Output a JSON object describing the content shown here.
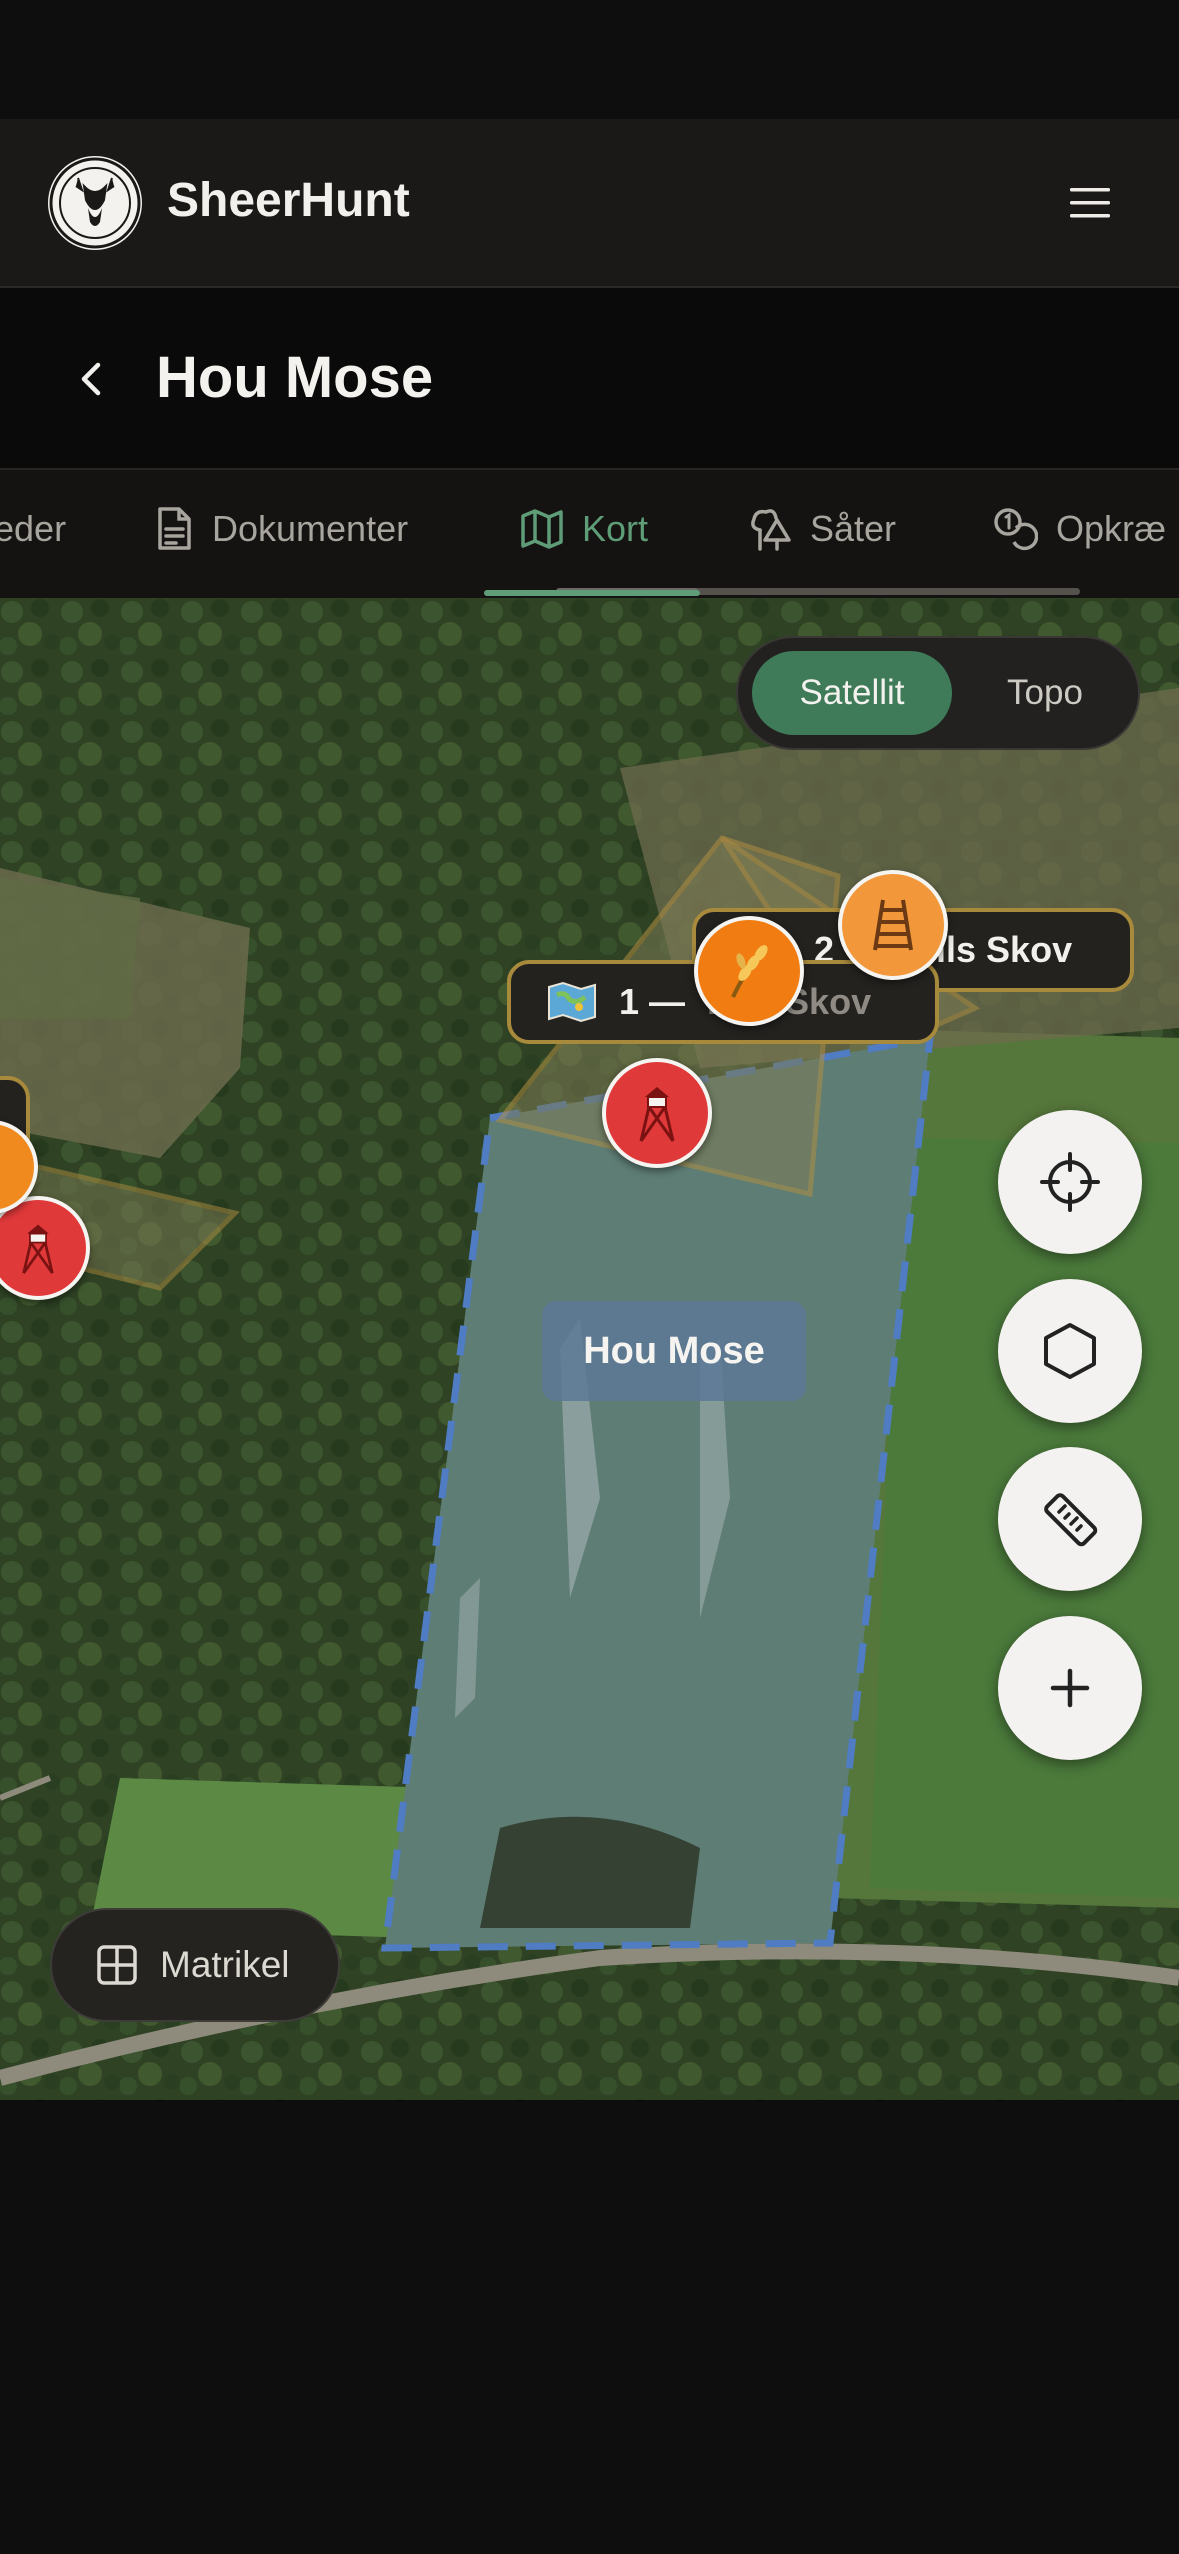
{
  "app": {
    "name": "SheerHunt",
    "logo_text": "SHEERHUNT"
  },
  "page": {
    "title": "Hou Mose"
  },
  "tabs": [
    {
      "label": "eder",
      "icon": "users-icon",
      "active": false
    },
    {
      "label": "Dokumenter",
      "icon": "document-icon",
      "active": false
    },
    {
      "label": "Kort",
      "icon": "map-icon",
      "active": true
    },
    {
      "label": "Såter",
      "icon": "trees-icon",
      "active": false
    },
    {
      "label": "Opkræ",
      "icon": "coins-icon",
      "active": false
    }
  ],
  "map": {
    "layer_toggle": {
      "satellit": "Satellit",
      "topo": "Topo",
      "selected": "Satellit"
    },
    "labels": {
      "area1_text": "1 — ",
      "area1_obscured": "Rus Skov",
      "area1_icon": "map-emoji-icon",
      "area2_number": "2",
      "area2_text": "dils Skov",
      "zone": "Hou Mose"
    },
    "pins": [
      {
        "type": "tower",
        "color": "#e0393a",
        "icon": "tower-icon"
      },
      {
        "type": "feeding",
        "color": "#f08a1f",
        "icon": "wheat-icon"
      },
      {
        "type": "ladder",
        "color": "#f2983a",
        "icon": "ladder-icon"
      }
    ],
    "tools": [
      "locate-icon",
      "polygon-icon",
      "ruler-icon",
      "plus-icon"
    ],
    "matrikel_label": "Matrikel"
  },
  "colors": {
    "accent": "#5f9d78",
    "boundary": "#a88a3c",
    "zone": "#5c7896"
  }
}
